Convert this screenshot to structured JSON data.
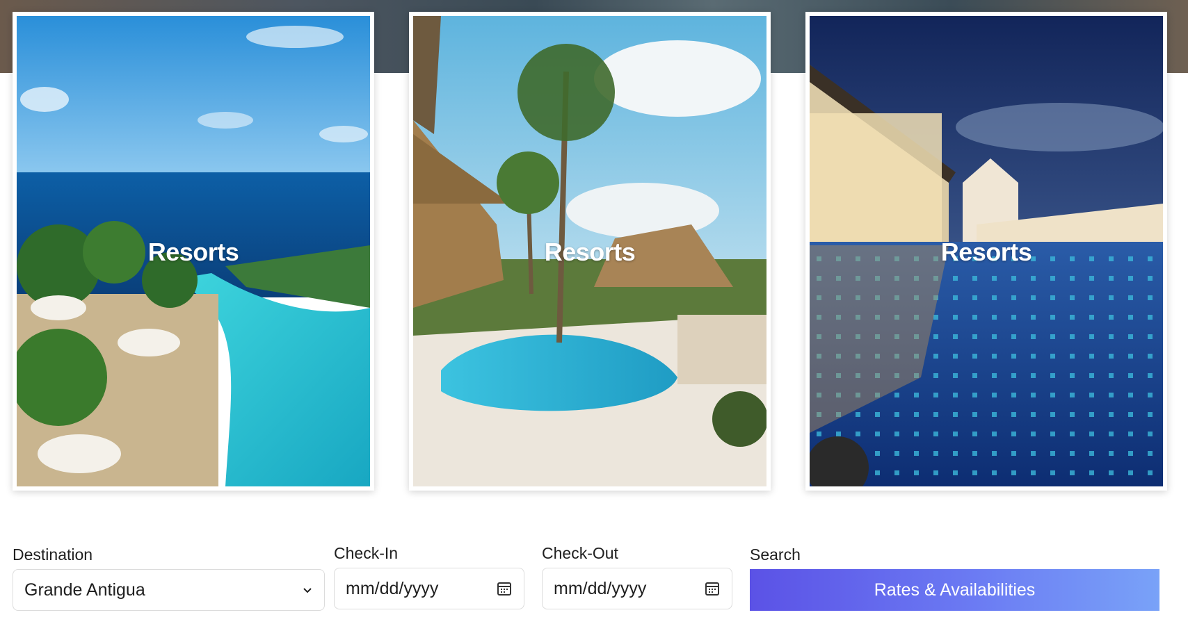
{
  "cards": [
    {
      "title": "Resorts"
    },
    {
      "title": "Resorts"
    },
    {
      "title": "Resorts"
    }
  ],
  "form": {
    "destination_label": "Destination",
    "destination_value": "Grande Antigua",
    "checkin_label": "Check-In",
    "checkin_placeholder": "mm/dd/yyyy",
    "checkout_label": "Check-Out",
    "checkout_placeholder": "mm/dd/yyyy",
    "search_label": "Search",
    "search_button": "Rates & Availabilities"
  },
  "icons": {
    "destination_dropdown": "chevron-down-icon",
    "checkin_calendar": "calendar-icon",
    "checkout_calendar": "calendar-icon"
  },
  "colors": {
    "button_gradient_start": "#5b52e6",
    "button_gradient_end": "#79a2f8"
  }
}
